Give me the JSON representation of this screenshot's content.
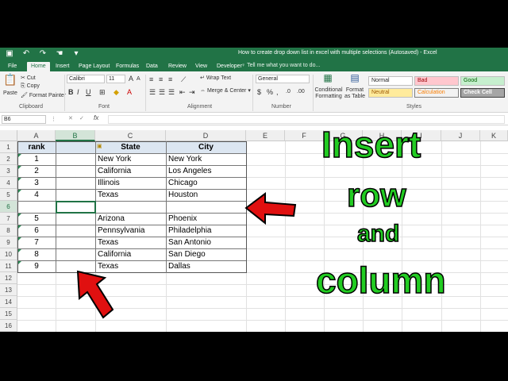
{
  "window": {
    "title": "How to create drop down list in excel with multiple selections (Autosaved) - Excel"
  },
  "tabs": [
    "File",
    "Home",
    "Insert",
    "Page Layout",
    "Formulas",
    "Data",
    "Review",
    "View",
    "Developer"
  ],
  "tellme": "Tell me what you want to do...",
  "ribbon": {
    "clipboard": {
      "paste": "Paste",
      "cut": "Cut",
      "copy": "Copy",
      "format_painter": "Format Painter",
      "label": "Clipboard"
    },
    "font": {
      "name": "Calibri",
      "size": "11",
      "label": "Font"
    },
    "alignment": {
      "wrap": "Wrap Text",
      "merge": "Merge & Center",
      "label": "Alignment"
    },
    "number": {
      "format": "General",
      "label": "Number"
    },
    "styles": {
      "conditional": "Conditional Formatting",
      "format_table": "Format as Table",
      "normal": "Normal",
      "bad": "Bad",
      "good": "Good",
      "neutral": "Neutral",
      "calculation": "Calculation",
      "check_cell": "Check Cell",
      "label": "Styles"
    }
  },
  "formula_bar": {
    "name_box": "B6",
    "fx": "fx"
  },
  "columns": [
    "A",
    "B",
    "C",
    "D",
    "E",
    "F",
    "G",
    "H",
    "I",
    "J",
    "K"
  ],
  "rows": [
    "1",
    "2",
    "3",
    "4",
    "5",
    "6",
    "7",
    "8",
    "9",
    "10",
    "11",
    "12",
    "13",
    "14",
    "15",
    "16"
  ],
  "table": {
    "headers": {
      "rank": "rank",
      "state": "State",
      "city": "City"
    },
    "data": [
      {
        "rank": "1",
        "state": "New York",
        "city": "New York"
      },
      {
        "rank": "2",
        "state": "California",
        "city": "Los Angeles"
      },
      {
        "rank": "3",
        "state": "Illinois",
        "city": "Chicago"
      },
      {
        "rank": "4",
        "state": "Texas",
        "city": "Houston"
      },
      {
        "rank": "",
        "state": "",
        "city": ""
      },
      {
        "rank": "5",
        "state": "Arizona",
        "city": "Phoenix"
      },
      {
        "rank": "6",
        "state": "Pennsylvania",
        "city": "Philadelphia"
      },
      {
        "rank": "7",
        "state": "Texas",
        "city": "San Antonio"
      },
      {
        "rank": "8",
        "state": "California",
        "city": "San Diego"
      },
      {
        "rank": "9",
        "state": "Texas",
        "city": "Dallas"
      }
    ]
  },
  "overlay": {
    "line1": "Insert",
    "line2": "row",
    "line3": "and",
    "line4": "column",
    "text_color": "#22cc22",
    "arrow_color": "#e01010"
  },
  "colors": {
    "excel_green": "#217346"
  }
}
